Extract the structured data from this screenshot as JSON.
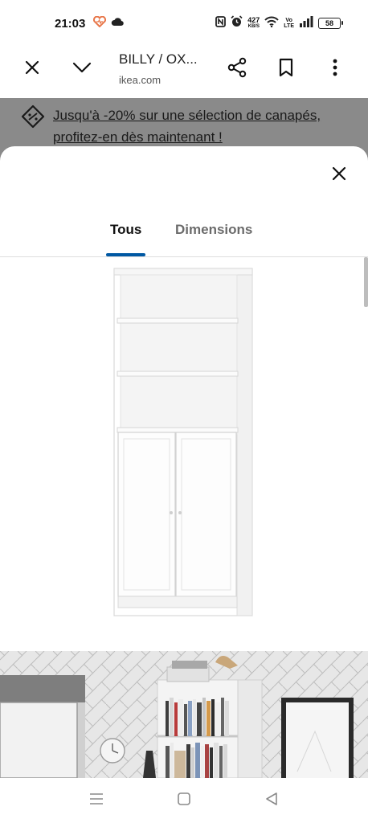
{
  "status_bar": {
    "time": "21:03",
    "left_icons": [
      "health-icon",
      "cloud-icon"
    ],
    "right_icons": [
      "nfc-icon",
      "alarm-icon",
      "wifi-icon",
      "volte-icon",
      "signal-icon"
    ],
    "net_speed_value": "427",
    "net_speed_unit": "KB/S",
    "volte_top": "Vo",
    "volte_bottom": "LTE",
    "battery": "58"
  },
  "browser": {
    "page_title": "BILLY / OX...",
    "domain": "ikea.com",
    "buttons": [
      "close-icon",
      "chevron-down-icon",
      "share-icon",
      "bookmark-icon",
      "more-vert-icon"
    ]
  },
  "promo": {
    "text": "Jusqu'à -20% sur une sélection de canapés, profitez-en dès maintenant !",
    "icon": "discount-tag-icon"
  },
  "sheet": {
    "close_icon": "close-icon",
    "tabs": [
      {
        "label": "Tous",
        "selected": true
      },
      {
        "label": "Dimensions",
        "selected": false
      }
    ],
    "colors": {
      "accent": "#0058a3",
      "backdrop": "#8a8a8a"
    }
  },
  "nav_bar": {
    "buttons": [
      "recents-icon",
      "home-icon",
      "back-icon"
    ]
  }
}
